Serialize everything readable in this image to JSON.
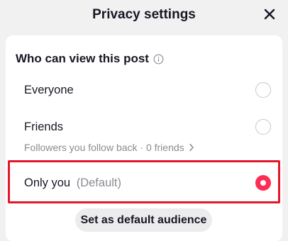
{
  "header": {
    "title": "Privacy settings"
  },
  "section": {
    "title": "Who can view this post"
  },
  "options": [
    {
      "label": "Everyone",
      "selected": false
    },
    {
      "label": "Friends",
      "sublabel": "Followers you follow back · 0 friends",
      "selected": false
    },
    {
      "label": "Only you",
      "default_tag": "(Default)",
      "selected": true
    }
  ],
  "actions": {
    "set_default_label": "Set as default audience"
  },
  "colors": {
    "accent": "#fe2c55",
    "highlight": "#e3162b",
    "muted_text": "#8a8b91"
  }
}
